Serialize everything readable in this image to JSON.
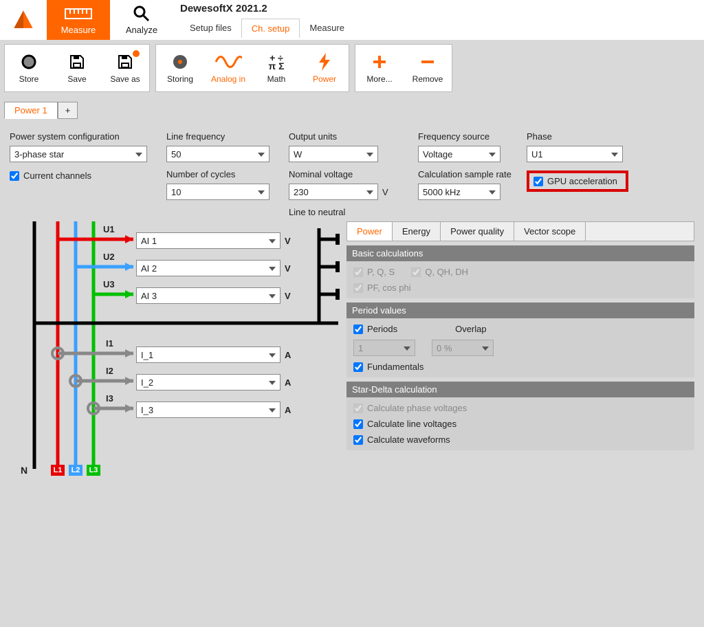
{
  "app": {
    "title": "DewesoftX 2021.2"
  },
  "mainTabs": {
    "measure": "Measure",
    "analyze": "Analyze"
  },
  "subTabs": {
    "setup_files": "Setup files",
    "ch_setup": "Ch. setup",
    "measure": "Measure"
  },
  "toolbar": {
    "store": "Store",
    "save": "Save",
    "saveas": "Save as",
    "storing": "Storing",
    "analogin": "Analog in",
    "math": "Math",
    "power": "Power",
    "more": "More...",
    "remove": "Remove"
  },
  "moduleTabs": {
    "power1": "Power 1",
    "plus": "+"
  },
  "config": {
    "psc_label": "Power system configuration",
    "psc_value": "3-phase star",
    "current_channels": "Current channels",
    "lf_label": "Line frequency",
    "lf_value": "50",
    "nc_label": "Number of cycles",
    "nc_value": "10",
    "ou_label": "Output units",
    "ou_value": "W",
    "nv_label": "Nominal voltage",
    "nv_value": "230",
    "nv_unit": "V",
    "ltn": "Line to neutral",
    "fs_label": "Frequency source",
    "fs_value": "Voltage",
    "csr_label": "Calculation sample rate",
    "csr_value": "5000 kHz",
    "ph_label": "Phase",
    "ph_value": "U1",
    "gpu": "GPU acceleration"
  },
  "channels": {
    "u1_label": "U1",
    "u1_val": "AI 1",
    "u2_label": "U2",
    "u2_val": "AI 2",
    "u3_label": "U3",
    "u3_val": "AI 3",
    "i1_label": "I1",
    "i1_val": "I_1",
    "i2_label": "I2",
    "i2_val": "I_2",
    "i3_label": "I3",
    "i3_val": "I_3",
    "v": "V",
    "a": "A",
    "n": "N",
    "l1": "L1",
    "l2": "L2",
    "l3": "L3"
  },
  "right": {
    "tabs": {
      "power": "Power",
      "energy": "Energy",
      "pq": "Power quality",
      "vs": "Vector scope"
    },
    "basic_head": "Basic calculations",
    "pqs": "P, Q, S",
    "qqhdh": "Q, QH, DH",
    "pf": "PF, cos phi",
    "period_head": "Period values",
    "periods": "Periods",
    "overlap_label": "Overlap",
    "periods_val": "1",
    "overlap_val": "0 %",
    "fundamentals": "Fundamentals",
    "sd_head": "Star-Delta calculation",
    "calc_phase": "Calculate phase voltages",
    "calc_line": "Calculate line voltages",
    "calc_wave": "Calculate waveforms"
  }
}
